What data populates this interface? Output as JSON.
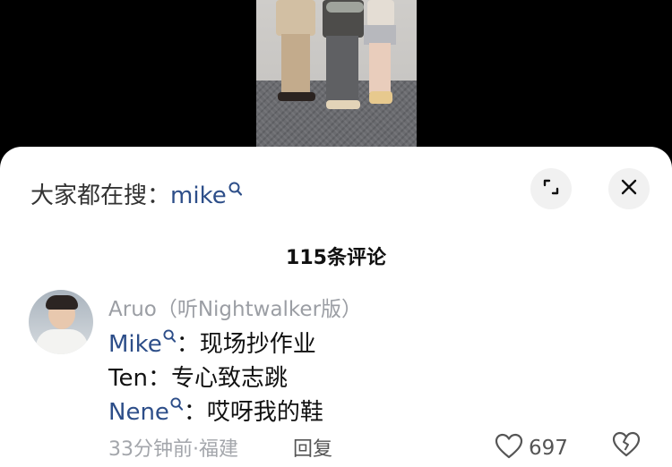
{
  "search": {
    "prefix": "大家都在搜：",
    "keyword": "mike"
  },
  "comments_header": {
    "count_label": "115条评论"
  },
  "comment": {
    "username": "Aruo（听Nightwalker版）",
    "lines": [
      {
        "mention": "Mike",
        "text": "：现场抄作业"
      },
      {
        "plain": "Ten：专心致志跳"
      },
      {
        "mention": "Nene",
        "text": "：哎呀我的鞋"
      }
    ],
    "meta": "33分钟前·福建",
    "reply_label": "回复",
    "like_count": "697"
  },
  "icons": {
    "search": "search-icon",
    "expand": "expand-icon",
    "close": "close-icon",
    "like": "heart-icon",
    "dislike": "broken-heart-icon"
  },
  "colors": {
    "mention_blue": "#2d4e89",
    "meta_gray": "#a3a6ab"
  }
}
